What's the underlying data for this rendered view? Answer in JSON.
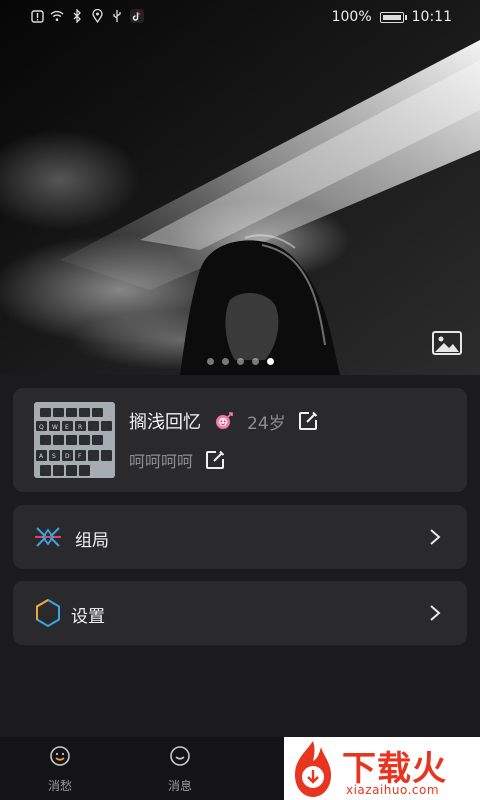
{
  "status_bar": {
    "battery": "100%",
    "time": "10:11",
    "icons": [
      "alert-icon",
      "wifi-icon",
      "bluetooth-icon",
      "location-icon",
      "usb-icon",
      "tiktok-icon"
    ]
  },
  "hero": {
    "slide_count": 5,
    "active_slide": 5,
    "gallery_icon": "image-icon"
  },
  "profile": {
    "name": "搁浅回忆",
    "gender_icon": "female-icon",
    "age": "24岁",
    "signature": "呵呵呵呵"
  },
  "menu": {
    "items": [
      {
        "label": "组局",
        "icon": "group-event-icon"
      },
      {
        "label": "设置",
        "icon": "hexagon-settings-icon"
      }
    ]
  },
  "bottom_nav": {
    "items": [
      {
        "label": "消愁",
        "icon": "smile-face-icon"
      },
      {
        "label": "消息",
        "icon": "message-icon"
      }
    ]
  },
  "watermark": {
    "title": "下载火",
    "subtitle": "xiazaihuo.com"
  },
  "colors": {
    "background": "#1b1b1d",
    "card": "#2a2a2c",
    "accent_blue": "#3aa6e0",
    "watermark_red": "#e8351f"
  }
}
